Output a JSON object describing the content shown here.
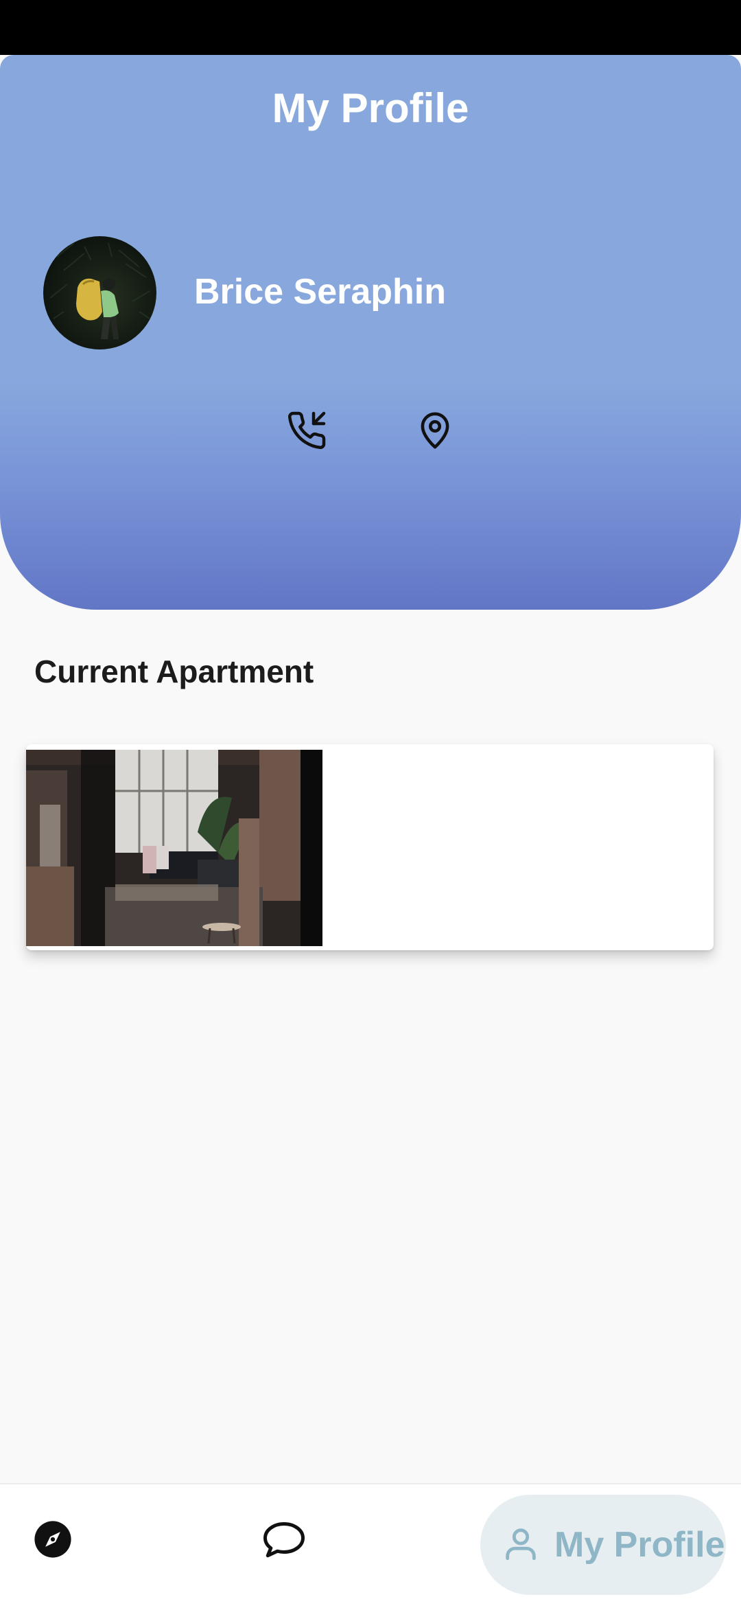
{
  "header": {
    "title": "My Profile",
    "user_name": "Brice Seraphin",
    "actions": [
      {
        "icon": "phone-incoming-icon"
      },
      {
        "icon": "map-pin-icon"
      }
    ]
  },
  "sections": {
    "current_apartment_title": "Current Apartment"
  },
  "bottom_nav": {
    "items": [
      {
        "icon": "compass-icon"
      },
      {
        "icon": "chat-bubble-icon"
      },
      {
        "icon": "user-icon",
        "label": "My Profile",
        "active": true
      }
    ]
  },
  "colors": {
    "header_gradient_top": "#88a8dd",
    "header_gradient_bottom": "#6276c6",
    "active_nav_bg": "#e6eef1",
    "active_nav_fg": "#8fb6c6"
  }
}
